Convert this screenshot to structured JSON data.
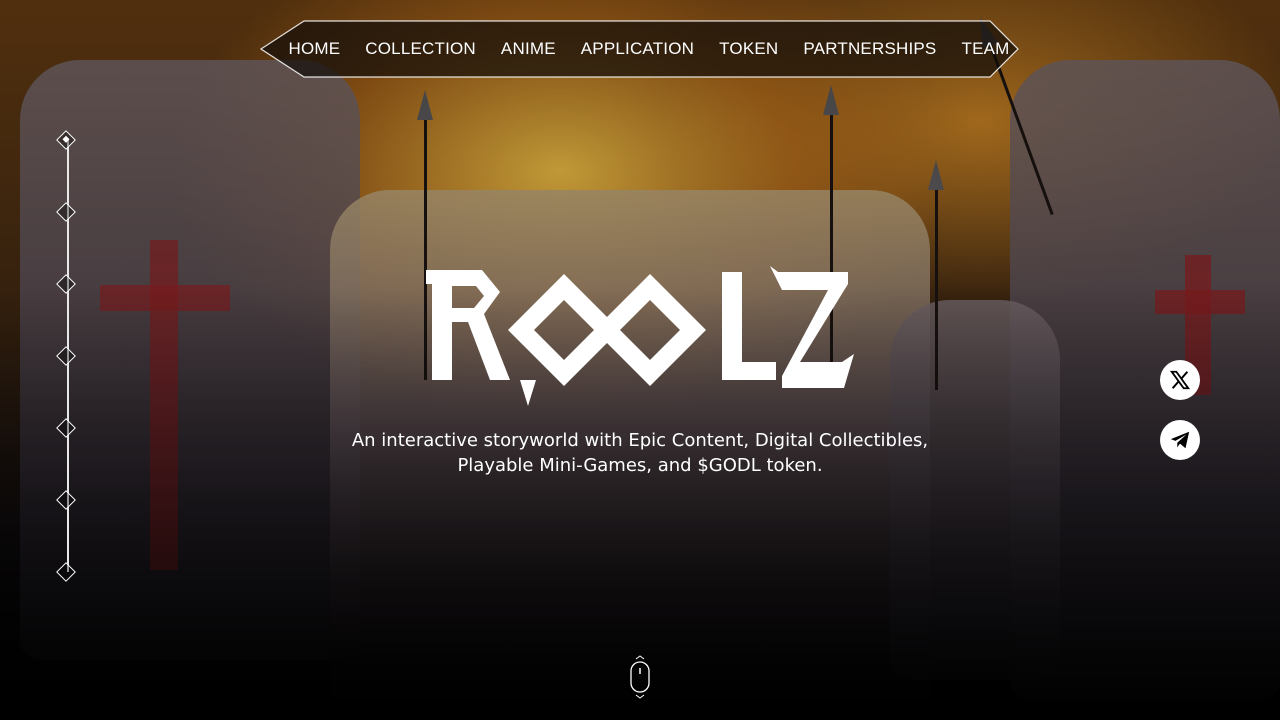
{
  "nav": {
    "items": [
      "HOME",
      "COLLECTION",
      "ANIME",
      "APPLICATION",
      "TOKEN",
      "PARTNERSHIPS",
      "TEAM"
    ]
  },
  "side_nav": {
    "count": 7,
    "active_index": 0
  },
  "hero": {
    "logo_text": "ROOLZ",
    "tagline": "An interactive storyworld with Epic Content, Digital Collectibles, Playable Mini-Games, and $GODL token."
  },
  "social": [
    {
      "name": "x-icon"
    },
    {
      "name": "telegram-icon"
    }
  ],
  "colors": {
    "accent": "#ffffff",
    "nav_bg": "rgba(20,14,10,0.7)"
  }
}
